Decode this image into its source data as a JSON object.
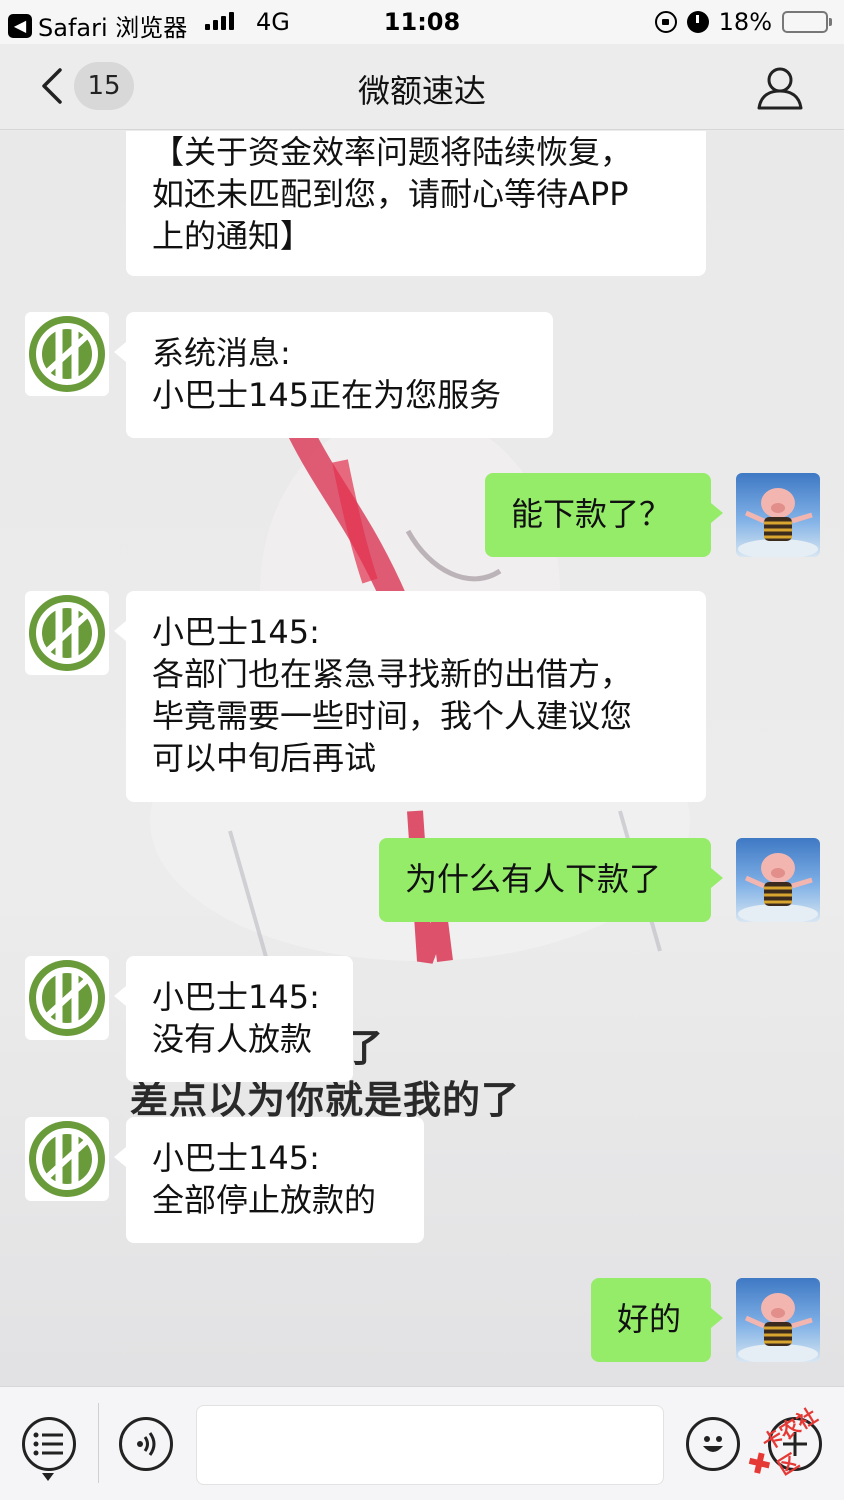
{
  "status_bar": {
    "back_app_label": "Safari 浏览器",
    "network": "4G",
    "time": "11:08",
    "battery_percent_text": "18%",
    "battery_level": 0.18
  },
  "nav": {
    "unread_count": "15",
    "title": "微额速达",
    "back_icon": "chevron-left-icon",
    "profile_icon": "person-icon"
  },
  "messages": [
    {
      "side": "left",
      "lines": [
        "【关于资金效率问题将陆续恢复，",
        "如还未匹配到您，请耐心等待APP",
        "上的通知】"
      ]
    },
    {
      "side": "left",
      "lines": [
        "系统消息:",
        "小巴士145正在为您服务"
      ]
    },
    {
      "side": "right",
      "lines": [
        "能下款了？"
      ]
    },
    {
      "side": "left",
      "lines": [
        "小巴士145:",
        "各部门也在紧急寻找新的出借方，",
        "毕竟需要一些时间，我个人建议您",
        "可以中旬后再试"
      ]
    },
    {
      "side": "right",
      "lines": [
        "为什么有人下款了"
      ]
    },
    {
      "side": "left",
      "lines": [
        "小巴士145:",
        "没有人放款"
      ]
    },
    {
      "side": "left",
      "lines": [
        "小巴士145:",
        "全部停止放款的"
      ]
    },
    {
      "side": "right",
      "lines": [
        "好的"
      ]
    }
  ],
  "wallpaper_text": {
    "line_1_tail": "了",
    "line_2": "差点以为你就是我的了"
  },
  "input_bar": {
    "menu_icon": "list-menu-icon",
    "voice_icon": "voice-icon",
    "emoji_icon": "emoji-icon",
    "plus_icon": "plus-icon"
  },
  "watermark": {
    "text": "卡农社区"
  },
  "colors": {
    "green_bubble": "#95ec69",
    "white_bubble": "#ffffff",
    "bot_logo_green": "#6a9b3a",
    "battery_low": "#ff3b30"
  }
}
